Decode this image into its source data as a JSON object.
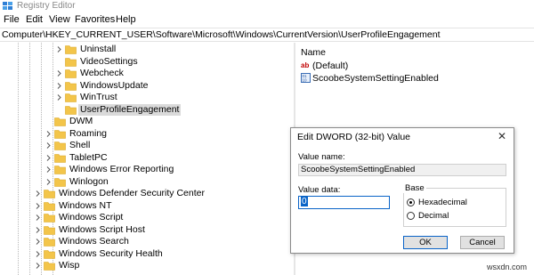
{
  "window": {
    "title": "Registry Editor"
  },
  "menu": [
    "File",
    "Edit",
    "View",
    "Favorites",
    "Help"
  ],
  "address": "Computer\\HKEY_CURRENT_USER\\Software\\Microsoft\\Windows\\CurrentVersion\\UserProfileEngagement",
  "tree": {
    "items": [
      {
        "label": "Uninstall",
        "expandable": true,
        "selected": false
      },
      {
        "label": "VideoSettings",
        "expandable": false,
        "selected": false
      },
      {
        "label": "Webcheck",
        "expandable": true,
        "selected": false
      },
      {
        "label": "WindowsUpdate",
        "expandable": true,
        "selected": false
      },
      {
        "label": "WinTrust",
        "expandable": true,
        "selected": false
      },
      {
        "label": "UserProfileEngagement",
        "expandable": false,
        "selected": true
      },
      {
        "label": "DWM",
        "expandable": false,
        "selected": false
      },
      {
        "label": "Roaming",
        "expandable": true,
        "selected": false
      },
      {
        "label": "Shell",
        "expandable": true,
        "selected": false
      },
      {
        "label": "TabletPC",
        "expandable": true,
        "selected": false
      },
      {
        "label": "Windows Error Reporting",
        "expandable": true,
        "selected": false
      },
      {
        "label": "Winlogon",
        "expandable": true,
        "selected": false
      },
      {
        "label": "Windows Defender Security Center",
        "expandable": true,
        "selected": false
      },
      {
        "label": "Windows NT",
        "expandable": true,
        "selected": false
      },
      {
        "label": "Windows Script",
        "expandable": true,
        "selected": false
      },
      {
        "label": "Windows Script Host",
        "expandable": true,
        "selected": false
      },
      {
        "label": "Windows Search",
        "expandable": true,
        "selected": false
      },
      {
        "label": "Windows Security Health",
        "expandable": true,
        "selected": false
      },
      {
        "label": "Wisp",
        "expandable": true,
        "selected": false
      }
    ]
  },
  "values": {
    "column_name": "Name",
    "rows": [
      {
        "name": "(Default)",
        "icon": "string-value-icon"
      },
      {
        "name": "ScoobeSystemSettingEnabled",
        "icon": "dword-value-icon"
      }
    ]
  },
  "dialog": {
    "title": "Edit DWORD (32-bit) Value",
    "value_name_label": "Value name:",
    "value_name": "ScoobeSystemSettingEnabled",
    "value_data_label": "Value data:",
    "value_data": "0",
    "base_label": "Base",
    "radios": [
      {
        "label": "Hexadecimal",
        "checked": true
      },
      {
        "label": "Decimal",
        "checked": false
      }
    ],
    "ok_label": "OK",
    "cancel_label": "Cancel",
    "close_glyph": "✕"
  },
  "watermark": "wsxdn.com",
  "colors": {
    "folder": "#f3c54a",
    "selection": "#dadada",
    "accent": "#0a64c8"
  }
}
